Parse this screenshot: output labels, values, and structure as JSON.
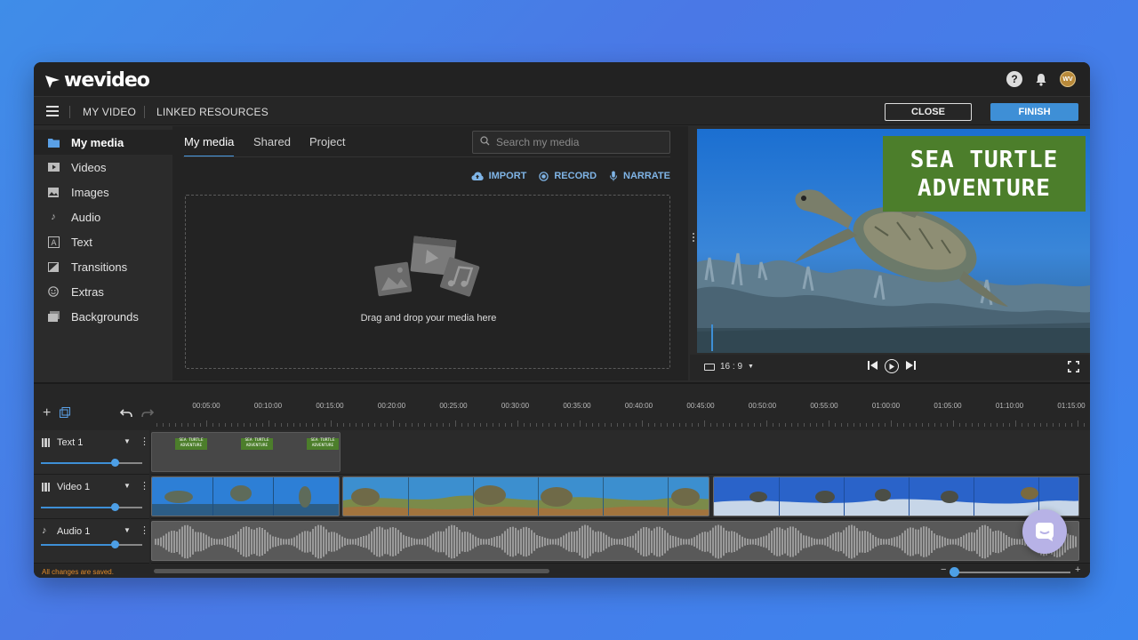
{
  "app": {
    "logo_text": "wevideo"
  },
  "topbar": {
    "avatar_initials": "WV"
  },
  "menubar": {
    "my_video": "MY VIDEO",
    "linked_resources": "LINKED RESOURCES",
    "close_label": "CLOSE",
    "finish_label": "FINISH"
  },
  "sidebar": {
    "items": [
      {
        "label": "My media",
        "icon": "folder-icon",
        "active": true
      },
      {
        "label": "Videos",
        "icon": "video-icon"
      },
      {
        "label": "Images",
        "icon": "image-icon"
      },
      {
        "label": "Audio",
        "icon": "music-note-icon"
      },
      {
        "label": "Text",
        "icon": "text-icon"
      },
      {
        "label": "Transitions",
        "icon": "transition-icon"
      },
      {
        "label": "Extras",
        "icon": "smiley-icon"
      },
      {
        "label": "Backgrounds",
        "icon": "backgrounds-icon"
      }
    ]
  },
  "media": {
    "tabs": [
      {
        "label": "My media",
        "active": true
      },
      {
        "label": "Shared"
      },
      {
        "label": "Project"
      }
    ],
    "search_placeholder": "Search my media",
    "actions": {
      "import": "IMPORT",
      "record": "RECORD",
      "narrate": "NARRATE"
    },
    "drop_text": "Drag and drop your media here"
  },
  "preview": {
    "title_line1": "SEA TURTLE",
    "title_line2": "ADVENTURE",
    "aspect_ratio": "16 : 9"
  },
  "timeline": {
    "ruler_labels": [
      "00:05:00",
      "00:10:00",
      "00:15:00",
      "00:20:00",
      "00:25:00",
      "00:30:00",
      "00:35:00",
      "00:40:00",
      "00:45:00",
      "00:50:00",
      "00:55:00",
      "01:00:00",
      "01:05:00",
      "01:10:00",
      "01:15:00"
    ],
    "tracks": [
      {
        "name": "Text 1",
        "icon": "text-track-icon",
        "volume": 0.73
      },
      {
        "name": "Video 1",
        "icon": "film-icon",
        "volume": 0.73
      },
      {
        "name": "Audio 1",
        "icon": "music-note-icon",
        "volume": 0.73
      }
    ],
    "mini_title": "SEA TURTLE ADVENTURE",
    "status": "All changes are saved.",
    "zoom_level": 0.0
  },
  "colors": {
    "accent": "#3e8fd6",
    "title_card": "#4c7e2b",
    "status": "#e08a2a"
  }
}
